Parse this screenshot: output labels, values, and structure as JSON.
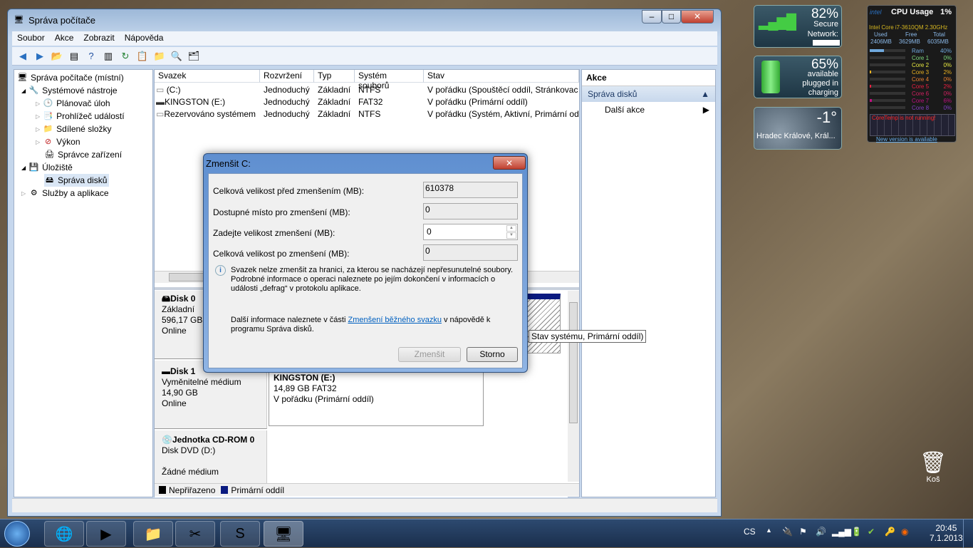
{
  "window": {
    "title": "Správa počítače",
    "menu": [
      "Soubor",
      "Akce",
      "Zobrazit",
      "Nápověda"
    ]
  },
  "tree": [
    {
      "label": "Správa počítače (místní)"
    },
    {
      "label": "Systémové nástroje"
    },
    {
      "label": "Plánovač úloh"
    },
    {
      "label": "Prohlížeč událostí"
    },
    {
      "label": "Sdílené složky"
    },
    {
      "label": "Výkon"
    },
    {
      "label": "Správce zařízení"
    },
    {
      "label": "Úložiště"
    },
    {
      "label": "Správa disků"
    },
    {
      "label": "Služby a aplikace"
    }
  ],
  "volumes": {
    "headers": [
      "Svazek",
      "Rozvržení",
      "Typ",
      "Systém souborů",
      "Stav"
    ],
    "rows": [
      [
        "(C:)",
        "Jednoduchý",
        "Základní",
        "NTFS",
        "V pořádku (Spouštěcí oddíl, Stránkovací"
      ],
      [
        "KINGSTON (E:)",
        "Jednoduchý",
        "Základní",
        "FAT32",
        "V pořádku (Primární oddíl)"
      ],
      [
        "Rezervováno systémem",
        "Jednoduchý",
        "Základní",
        "NTFS",
        "V pořádku (Systém, Aktivní, Primární od"
      ]
    ]
  },
  "disks": [
    {
      "name": "Disk 0",
      "type": "Základní",
      "size": "596,17 GB",
      "state": "Online"
    },
    {
      "name": "Disk 1",
      "type": "Vyměnitelné médium",
      "size": "14,90 GB",
      "state": "Online"
    },
    {
      "name": "Jednotka CD-ROM 0",
      "type": "Disk DVD (D:)",
      "size": "",
      "state": "Žádné médium"
    }
  ],
  "partition_e": {
    "name": "KINGSTON  (E:)",
    "size": "14,89 GB FAT32",
    "state": "V pořádku (Primární oddíl)"
  },
  "tooltip": "Stav systému, Primární oddíl)",
  "legend": [
    "Nepřiřazeno",
    "Primární oddíl"
  ],
  "actions": {
    "header": "Akce",
    "section": "Správa disků",
    "more": "Další akce"
  },
  "dialog": {
    "title": "Zmenšit C:",
    "fields": [
      {
        "label": "Celková velikost před zmenšením (MB):",
        "value": "610378"
      },
      {
        "label": "Dostupné místo pro zmenšení (MB):",
        "value": "0"
      },
      {
        "label": "Zadejte velikost zmenšení (MB):",
        "value": "0"
      },
      {
        "label": "Celková velikost po zmenšení (MB):",
        "value": "0"
      }
    ],
    "info": "Svazek nelze zmenšit za hranici, za kterou se nacházejí nepřesunutelné soubory. Podrobné informace o operaci naleznete po jejím dokončení v informacích o události „defrag“ v protokolu aplikace.",
    "more_prefix": "Další informace naleznete v části ",
    "more_link": "Zmenšení běžného svazku",
    "more_suffix": " v nápovědě k programu Správa disků.",
    "ok": "Zmenšit",
    "cancel": "Storno"
  },
  "gadgets": {
    "network": {
      "percent": "82%",
      "status": "Secure",
      "label": "Network:"
    },
    "battery": {
      "percent": "65%",
      "status": "available",
      "line1": "plugged in",
      "line2": "charging"
    },
    "weather": {
      "temp": "-1°",
      "city": "Hradec Králové, Král..."
    },
    "cpu": {
      "title": "CPU Usage",
      "total": "1%",
      "cpu_name": "Intel Core i7-3610QM 2.30GHz",
      "mem_headers": [
        "Used",
        "Free",
        "Total"
      ],
      "mem_values": [
        "2406MB",
        "3629MB",
        "6035MB"
      ],
      "rows": [
        {
          "label": "Ram",
          "value": "40%",
          "fill": 40,
          "color": "#6fa8dc"
        },
        {
          "label": "Core 1",
          "value": "0%",
          "fill": 0,
          "color": "#7dd87d"
        },
        {
          "label": "Core 2",
          "value": "0%",
          "fill": 0,
          "color": "#e8e840"
        },
        {
          "label": "Core 3",
          "value": "2%",
          "fill": 2,
          "color": "#e8b020"
        },
        {
          "label": "Core 4",
          "value": "0%",
          "fill": 0,
          "color": "#e88030"
        },
        {
          "label": "Core 5",
          "value": "2%",
          "fill": 2,
          "color": "#e82040"
        },
        {
          "label": "Core 6",
          "value": "0%",
          "fill": 0,
          "color": "#d02060"
        },
        {
          "label": "Core 7",
          "value": "6%",
          "fill": 6,
          "color": "#c01080"
        },
        {
          "label": "Core 8",
          "value": "0%",
          "fill": 0,
          "color": "#8040c0"
        }
      ],
      "warning": "CoreTemp is not running!",
      "update": "New version is available"
    }
  },
  "desktop": {
    "recycle_bin": "Koš"
  },
  "taskbar": {
    "lang": "CS",
    "time": "20:45",
    "date": "7.1.2013"
  }
}
